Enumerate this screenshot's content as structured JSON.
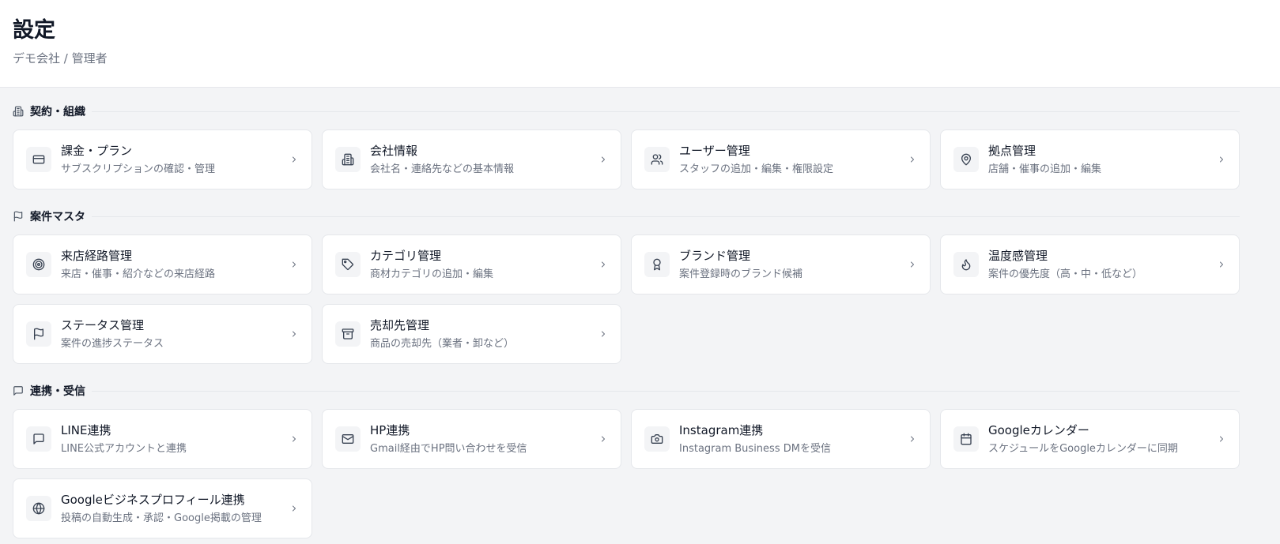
{
  "header": {
    "title": "設定",
    "subtitle": "デモ会社 / 管理者"
  },
  "sections": [
    {
      "label": "契約・組織",
      "icon": "building-icon",
      "cards": [
        {
          "title": "課金・プラン",
          "desc": "サブスクリプションの確認・管理",
          "icon": "credit-card-icon"
        },
        {
          "title": "会社情報",
          "desc": "会社名・連絡先などの基本情報",
          "icon": "building-icon"
        },
        {
          "title": "ユーザー管理",
          "desc": "スタッフの追加・編集・権限設定",
          "icon": "users-icon"
        },
        {
          "title": "拠点管理",
          "desc": "店舗・催事の追加・編集",
          "icon": "map-pin-icon"
        }
      ]
    },
    {
      "label": "案件マスタ",
      "icon": "flag-icon",
      "cards": [
        {
          "title": "来店経路管理",
          "desc": "来店・催事・紹介などの来店経路",
          "icon": "target-icon"
        },
        {
          "title": "カテゴリ管理",
          "desc": "商材カテゴリの追加・編集",
          "icon": "tag-icon"
        },
        {
          "title": "ブランド管理",
          "desc": "案件登録時のブランド候補",
          "icon": "award-icon"
        },
        {
          "title": "温度感管理",
          "desc": "案件の優先度（高・中・低など）",
          "icon": "flame-icon"
        },
        {
          "title": "ステータス管理",
          "desc": "案件の進捗ステータス",
          "icon": "flag-icon"
        },
        {
          "title": "売却先管理",
          "desc": "商品の売却先（業者・卸など）",
          "icon": "archive-icon"
        }
      ]
    },
    {
      "label": "連携・受信",
      "icon": "message-icon",
      "cards": [
        {
          "title": "LINE連携",
          "desc": "LINE公式アカウントと連携",
          "icon": "message-icon"
        },
        {
          "title": "HP連携",
          "desc": "Gmail経由でHP問い合わせを受信",
          "icon": "mail-icon"
        },
        {
          "title": "Instagram連携",
          "desc": "Instagram Business DMを受信",
          "icon": "camera-icon"
        },
        {
          "title": "Googleカレンダー",
          "desc": "スケジュールをGoogleカレンダーに同期",
          "icon": "calendar-icon"
        },
        {
          "title": "Googleビジネスプロフィール連携",
          "desc": "投稿の自動生成・承認・Google掲載の管理",
          "icon": "globe-icon"
        }
      ]
    }
  ]
}
